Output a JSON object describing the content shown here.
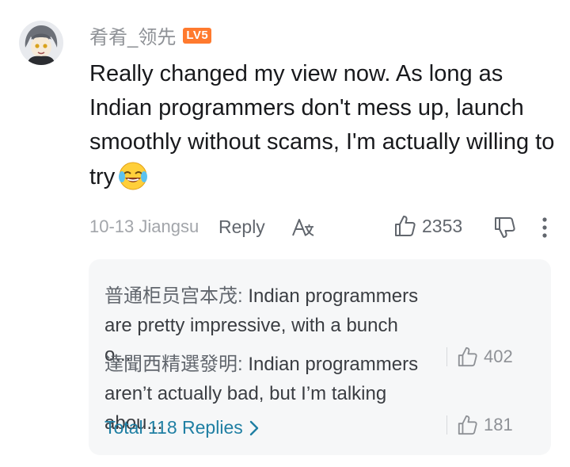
{
  "comment": {
    "username": "肴肴_领先",
    "level_badge": "LV5",
    "text": "Really changed my view now. As long as Indian programmers don't mess up, launch smoothly without scams, I'm actually willing to try",
    "date": "10-13",
    "location": "Jiangsu",
    "reply_label": "Reply",
    "like_count": "2353"
  },
  "replies": [
    {
      "author": "普通柜员宫本茂:",
      "text": "Indian programmers are pretty impressive, with a bunch o...",
      "likes": "402"
    },
    {
      "author": "達聞西精選發明:",
      "text": "Indian programmers aren’t actually bad, but I’m talking abou...",
      "likes": "181"
    }
  ],
  "total_replies_label": "Total 118 Replies",
  "icons": {
    "translate": "translate-icon",
    "like": "thumbs-up-icon",
    "dislike": "thumbs-down-icon",
    "more": "more-vertical-icon",
    "emoji": "laughing-crying-emoji-icon",
    "chevron": "chevron-right-icon"
  },
  "colors": {
    "level_badge": "#ff7a2e",
    "link": "#1f7fa3",
    "reply_background": "#f6f7f8"
  }
}
